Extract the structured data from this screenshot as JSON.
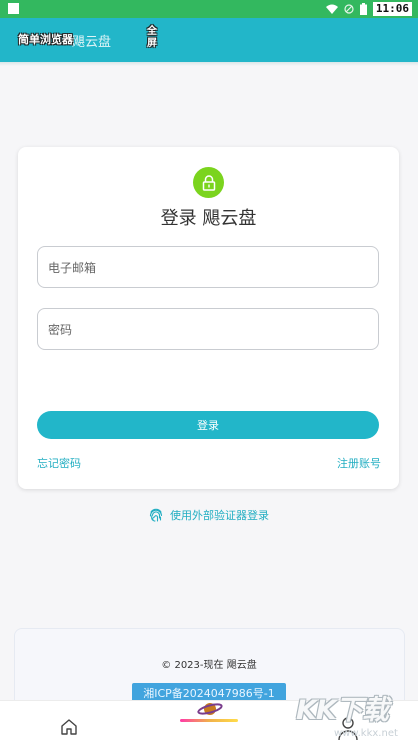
{
  "status_bar": {
    "time": "11:06"
  },
  "app_bar": {
    "browser_label": "简单浏览器",
    "title": "飓云盘",
    "fullscreen_label": "全屏"
  },
  "login_card": {
    "title": "登录 飓云盘",
    "email_placeholder": "电子邮箱",
    "password_placeholder": "密码",
    "login_button": "登录",
    "forgot_password": "忘记密码",
    "register": "注册账号"
  },
  "external_login": {
    "label": "使用外部验证器登录"
  },
  "footer": {
    "copyright": "© 2023-现在 飓云盘",
    "icp": "湘ICP备2024047986号-1"
  },
  "watermark": {
    "logo": "KK下载",
    "url": "www.kkx.net"
  },
  "colors": {
    "status_bar": "#33b85f",
    "app_bar": "#22b6c9",
    "accent": "#22b6c9",
    "lock_icon_bg": "#7bd41e",
    "icp_badge": "#41a4de"
  },
  "icons": {
    "lock": "lock-icon",
    "fingerprint": "fingerprint-icon",
    "home": "home-icon",
    "planet": "planet-icon",
    "profile": "profile-icon",
    "wifi": "wifi-icon",
    "battery": "battery-icon"
  }
}
